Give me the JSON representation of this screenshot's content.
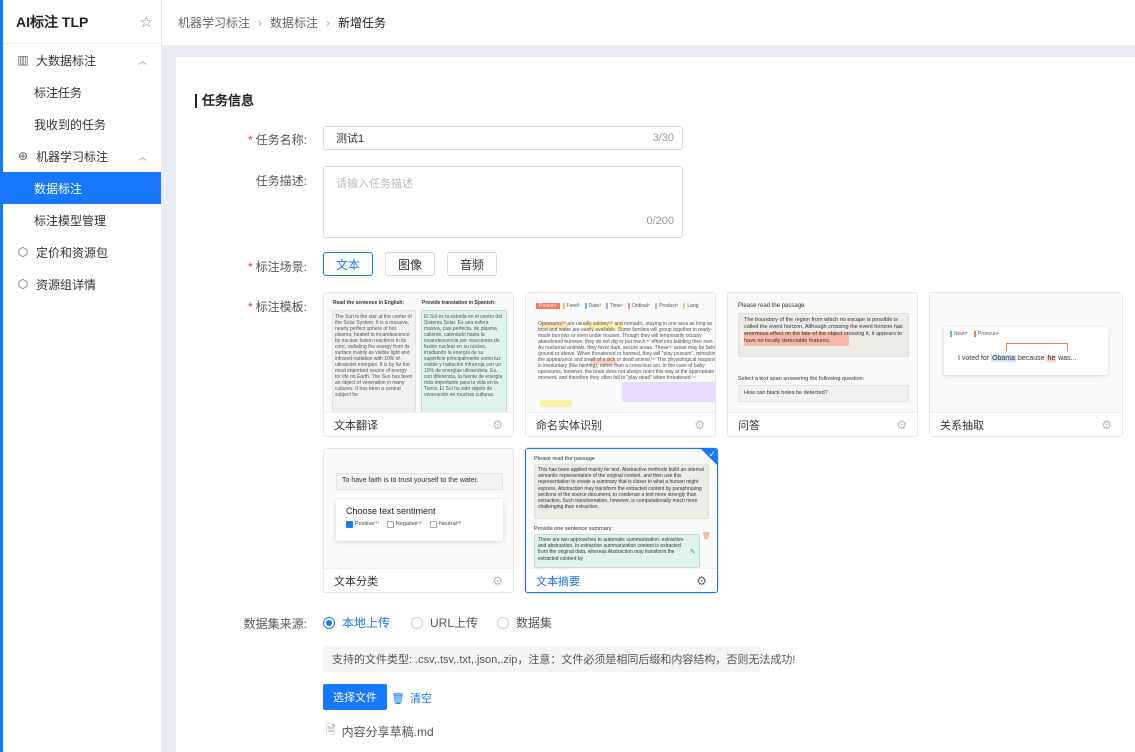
{
  "app": {
    "title": "AI标注 TLP"
  },
  "sidebar": {
    "groups": [
      {
        "label": "大数据标注",
        "icon": "columns-icon",
        "items": [
          "标注任务",
          "我收到的任务"
        ]
      },
      {
        "label": "机器学习标注",
        "icon": "crosshair-icon",
        "items": [
          "数据标注",
          "标注模型管理"
        ]
      },
      {
        "label": "定价和资源包",
        "icon": "cube-icon",
        "items": []
      },
      {
        "label": "资源组详情",
        "icon": "cube-icon",
        "items": []
      }
    ],
    "active_item": "数据标注"
  },
  "breadcrumb": [
    "机器学习标注",
    "数据标注",
    "新增任务"
  ],
  "form": {
    "section_title": "任务信息",
    "task_name": {
      "label": "任务名称:",
      "value": "测试1",
      "counter": "3/30"
    },
    "task_desc": {
      "label": "任务描述:",
      "placeholder": "请输入任务描述",
      "counter": "0/200"
    },
    "scene": {
      "label": "标注场景:",
      "options": [
        "文本",
        "图像",
        "音频"
      ],
      "selected": "文本"
    },
    "template": {
      "label": "标注模板:",
      "cards": [
        {
          "label": "文本翻译"
        },
        {
          "label": "命名实体识别"
        },
        {
          "label": "问答"
        },
        {
          "label": "关系抽取"
        },
        {
          "label": "文本分类"
        },
        {
          "label": "文本摘要"
        }
      ],
      "selected": "文本摘要"
    },
    "source": {
      "label": "数据集来源:",
      "options": [
        "本地上传",
        "URL上传",
        "数据集"
      ],
      "selected": "本地上传"
    },
    "hint": "支持的文件类型: .csv,.tsv,.txt,.json,.zip，注意：文件必须是相同后缀和内容结构，否则无法成功!",
    "upload_button": "选择文件",
    "clear_button": "清空",
    "file_name": "内容分享草稿.md"
  },
  "previews": {
    "translation": {
      "left_title": "Read the sentence in English:",
      "right_title": "Provide translation in Spanish:",
      "left_text": "The Sun is the star at the center of the Solar System. It is a massive, nearly perfect sphere of hot plasma, heated to incandescence by nuclear fusion reactions in its core, radiating the energy from its surface mainly as visible light and infrared radiation with 10% of ultraviolet energies. It is by far the most important source of energy for life on Earth. The Sun has been an object of veneration in many cultures. It has been a central subject for",
      "right_text": "El Sol es la estrella en el centro del Sistema Solar. Es una esfera masiva, casi perfecta, de plasma caliente, calentado hasta la incandescencia por reacciones de fusión nuclear en su núcleo, irradiando la energía de su superficie principalmente como luz visible y radiación infrarroja con un 10% de energías ultravioleta. Es, con diferencia, la fuente de energía más importante para la vida en la Tierra. El Sol ha sido objeto de veneración en muchas culturas"
    },
    "ner": {
      "tags": [
        "Person¹",
        "Food²",
        "Date³",
        "Time⁴",
        "Ordinal⁵",
        "Product⁶",
        "Lang"
      ],
      "text": "Opossums⁽²⁾ are usually solitary⁽³⁾ and nomadic, staying in one area as long as food and water are easily available. Some families will group together in ready-made burrows or even under houses. Though they will temporarily occupy abandoned burrows, they do not dig or put much⁽⁵⁾ effort into building their own. As nocturnal animals, they favor dark, secure areas. These⁽¹⁾ areas may be below ground or above. When threatened or harmed, they will \"play possum\", mimicking the appearance and smell of a sick or dead animal.⁽⁶⁾ This physiological response is involuntary (like fainting), rather than a conscious act. In the case of baby opossums, however, the brain does not always react this way at the appropriate moment, and therefore they often fail to \"play dead\" when threatened.⁽⁴⁾"
    },
    "qa": {
      "passage_title": "Please read the passage",
      "passage": "The boundary of the region from which no escape is possible is called the event horizon. Although crossing the event horizon has enormous effect on the fate of the object crossing it, it appears to have no locally detectable features.",
      "question_title": "Select a text span answering the following question:",
      "question": "How can black holes be detected?"
    },
    "relation": {
      "tags": [
        "Noun¹",
        "Pronoun²"
      ],
      "sentence_a": "I voted for",
      "entity_a": "Obama",
      "sentence_b": "because",
      "entity_b": "he",
      "sentence_c": "was..."
    },
    "classification": {
      "sentence": "To have faith is to trust yourself to the water.",
      "title": "Choose text sentiment",
      "options": [
        "Positive⁽¹⁾",
        "Negative⁽²⁾",
        "Neutral⁽³⁾"
      ]
    },
    "summary": {
      "passage_title": "Please read the passage",
      "passage": "This has been applied mainly for text. Abstractive methods build an internal semantic representation of the original content, and then use this representation to create a summary that is closer to what a human might express. Abstraction may transform the extracted content by paraphrasing sections of the source document, to condense a text more strongly than extraction. Such transformation, however, is computationally much more challenging than extraction.",
      "answer_title": "Provide one sentence summary:",
      "answer": "There are two approaches to automatic summarization: extraction and abstraction. In extraction summarization content is extracted from the original data, whereas Abstraction may transform the extracted content by"
    }
  },
  "colors": {
    "accent": "#1677ff",
    "required": "#e53935"
  }
}
